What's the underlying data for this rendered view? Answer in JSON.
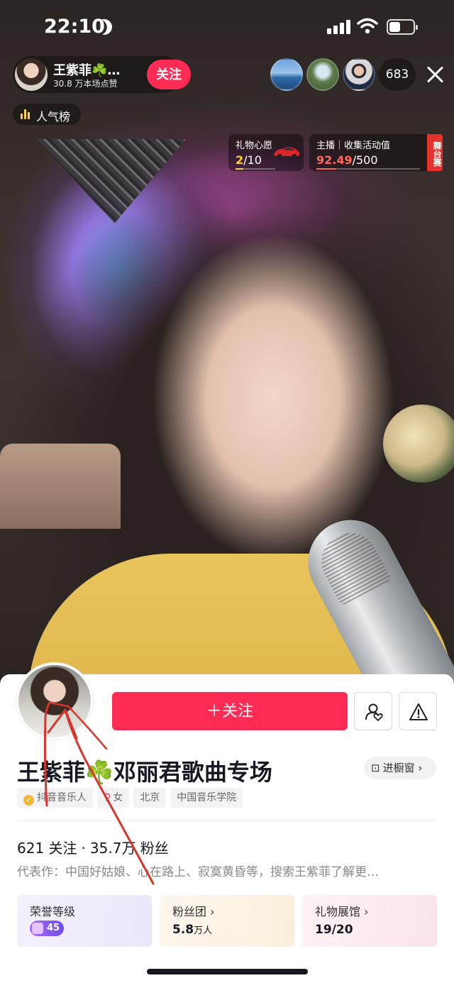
{
  "status_bar": {
    "time": "22:10"
  },
  "live_header": {
    "host_name": "王紫菲☘️…",
    "host_likes": "30.8 万本场点赞",
    "follow_label": "关注",
    "viewer_count": "683",
    "rank_label": "人气榜"
  },
  "gift_wish": {
    "title": "礼物心愿",
    "current": "2",
    "total": "/10",
    "progress": 0.2
  },
  "event": {
    "title": "主播｜收集活动值",
    "current": "92.49",
    "total": "/500",
    "progress": 0.185,
    "tag": "舞台赛"
  },
  "profile": {
    "follow_button": "＋关注",
    "title": "王紫菲☘️邓丽君歌曲专场",
    "shop_label": "进橱窗",
    "tags": [
      "抖音音乐人",
      "女",
      "北京",
      "中国音乐学院"
    ],
    "following_count": "621 关注",
    "dot": "·",
    "fans_count": "35.7万 粉丝",
    "bio": "代表作：中国好姑娘、心在路上、寂寞黄昏等，搜索王紫菲了解更…",
    "cards": {
      "honor_title": "荣誉等级",
      "honor_level": "45",
      "fan_group_title": "粉丝团 ›",
      "fan_group_value": "5.8",
      "fan_group_unit": "万人",
      "gift_hall_title": "礼物展馆 ›",
      "gift_hall_value": "19/20"
    }
  },
  "colors": {
    "accent": "#fe2c55",
    "gold": "#ffcf33",
    "event": "#ff6b5a"
  }
}
